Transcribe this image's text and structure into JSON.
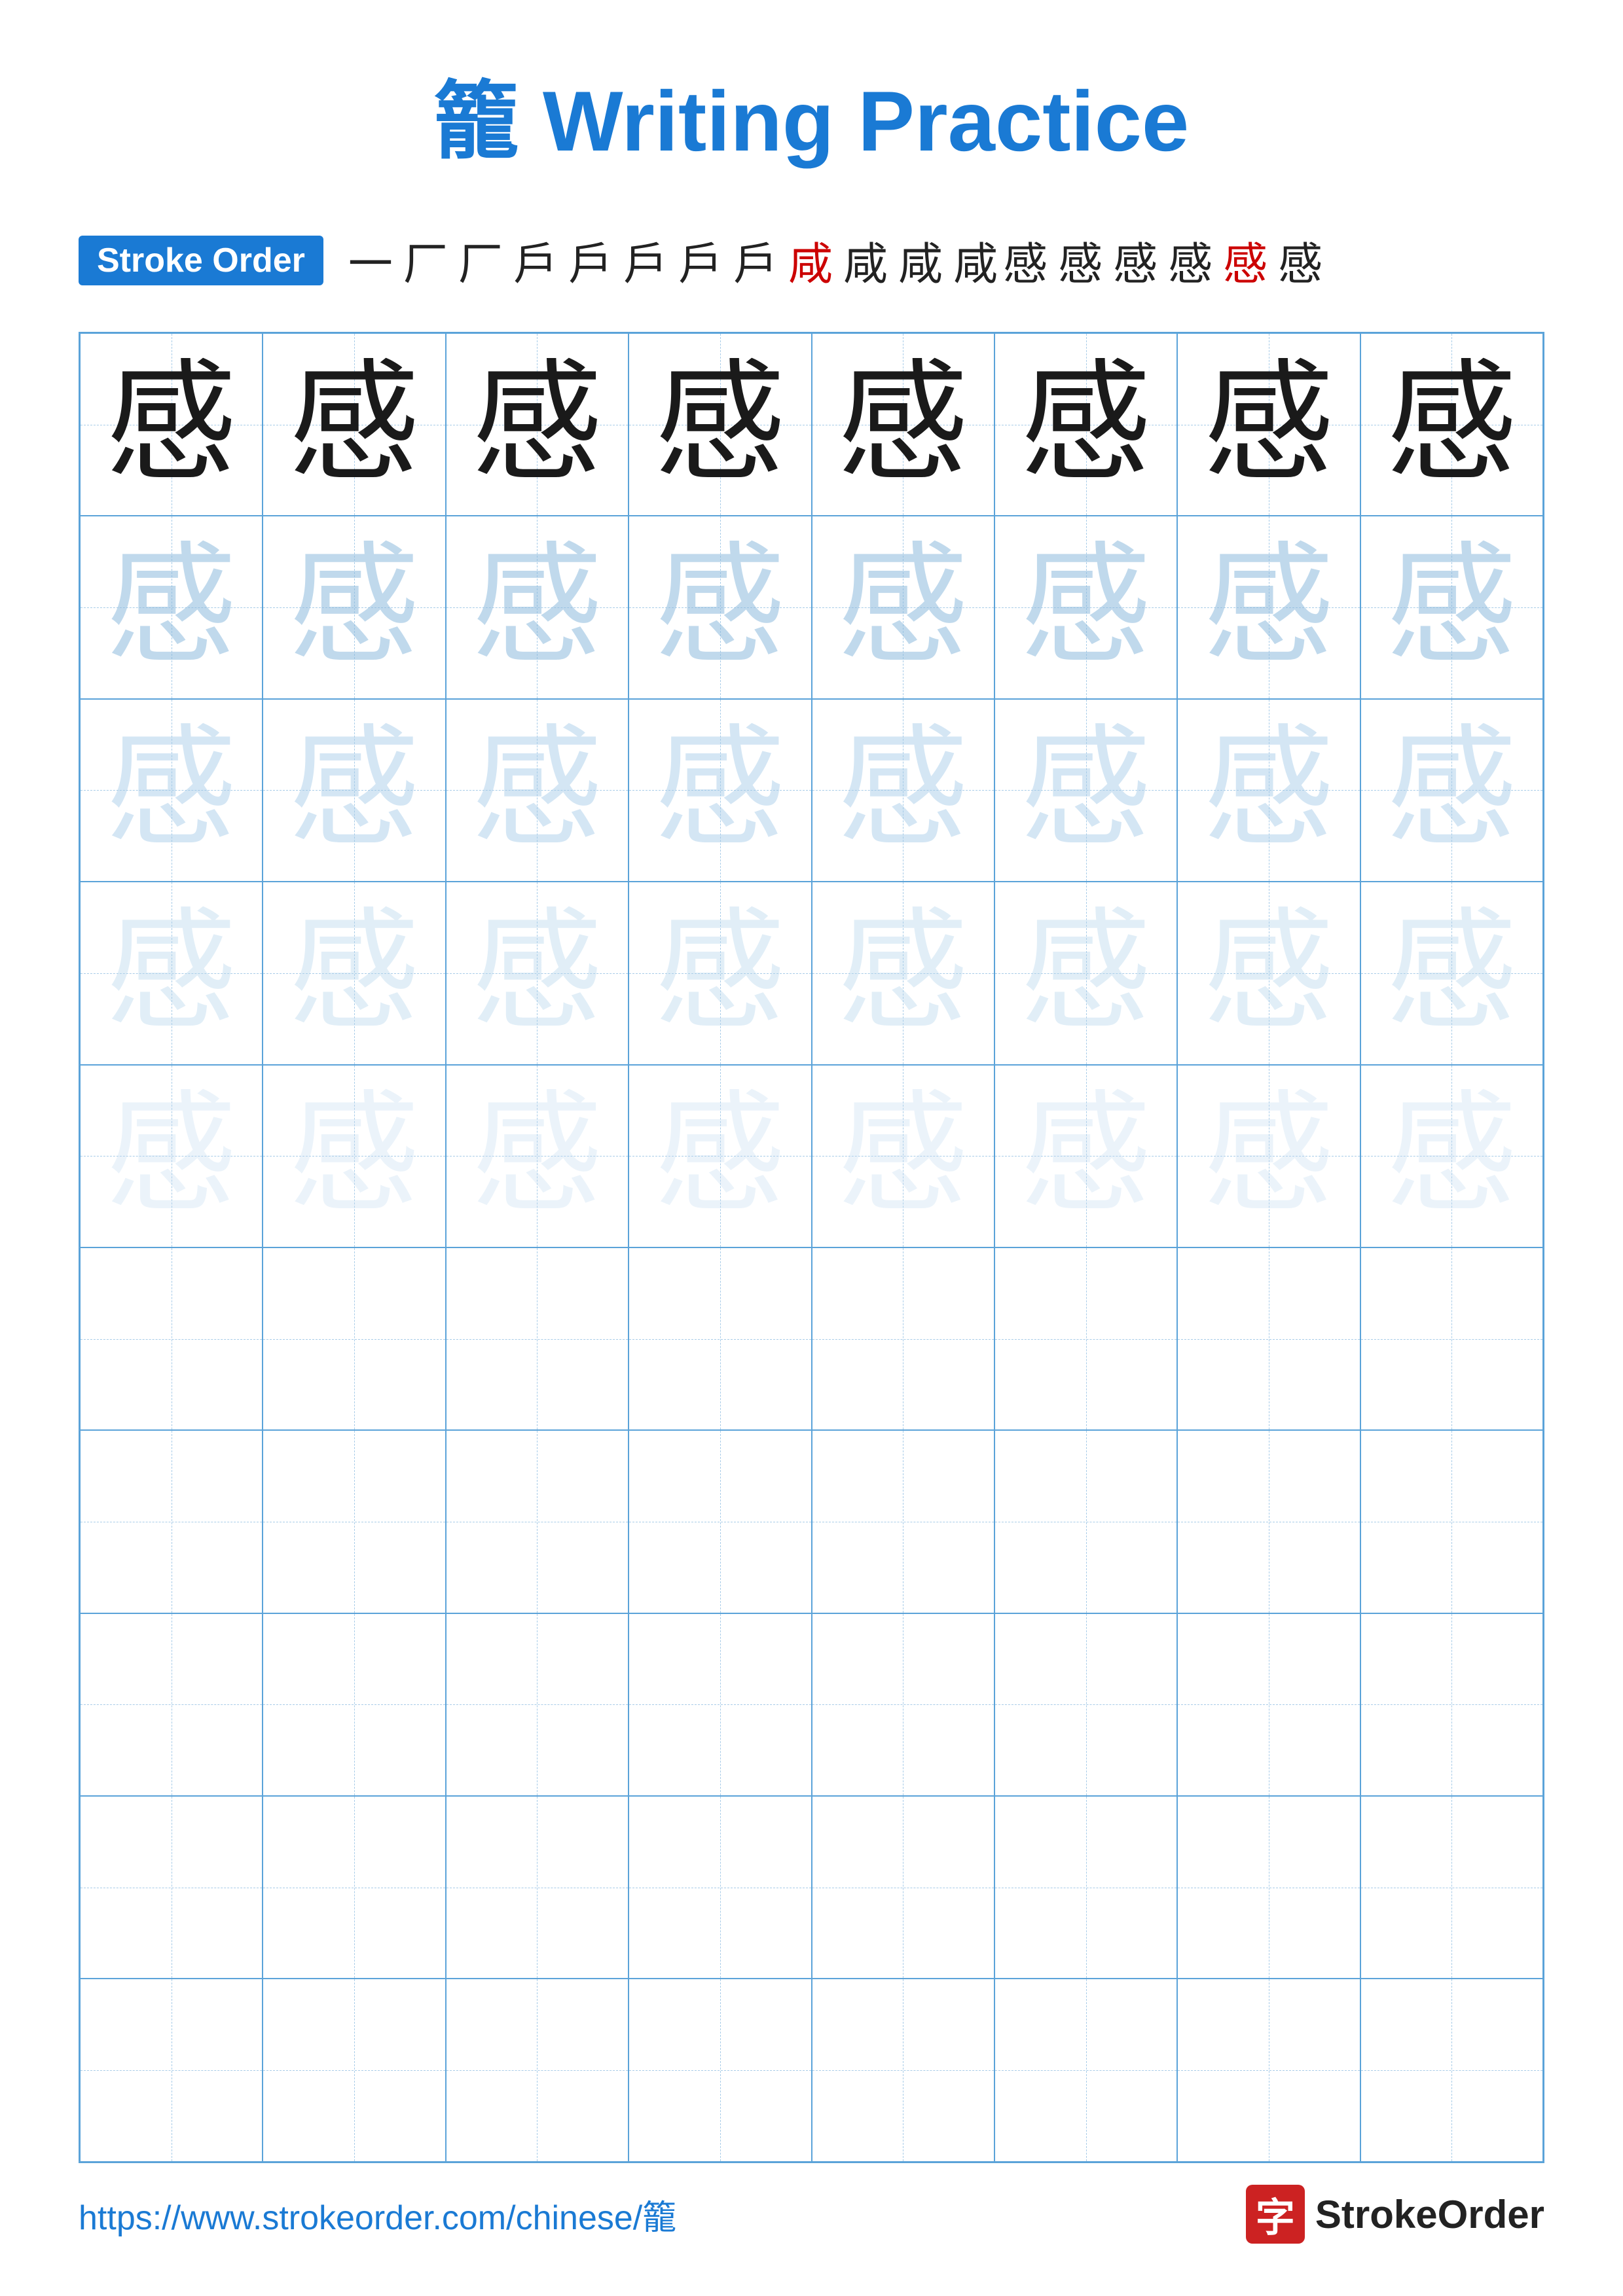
{
  "title": {
    "char": "籠",
    "text": " Writing Practice",
    "full": "籠 Writing Practice"
  },
  "stroke_order": {
    "badge_label": "Stroke Order",
    "strokes": [
      "一",
      "厂",
      "厂",
      "戶",
      "戶",
      "戶",
      "戶",
      "戶",
      "咸",
      "咸",
      "咸",
      "咸",
      "感",
      "感",
      "感",
      "感",
      "感",
      "感"
    ]
  },
  "practice_char": "感",
  "grid": {
    "rows": 10,
    "cols": 8
  },
  "footer": {
    "url": "https://www.strokeorder.com/chinese/籠",
    "logo_text": "StrokeOrder",
    "logo_icon": "字"
  }
}
